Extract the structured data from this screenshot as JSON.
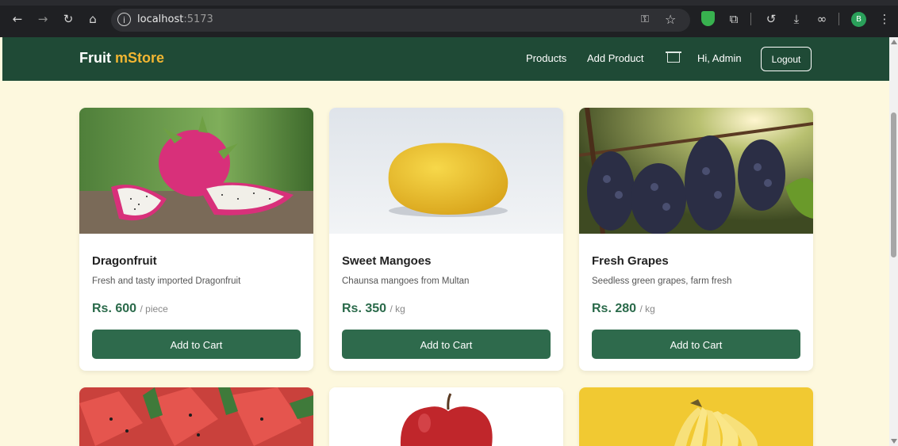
{
  "browser": {
    "host": "localhost",
    "port": ":5173",
    "profile_initial": "B"
  },
  "navbar": {
    "brand_first": "Fruit",
    "brand_second": "mStore",
    "links": [
      "Products",
      "Add Product"
    ],
    "greeting": "Hi, Admin",
    "logout_label": "Logout"
  },
  "products": [
    {
      "name": "Dragonfruit",
      "description": "Fresh and tasty imported Dragonfruit",
      "price": "Rs. 600",
      "unit": "/ piece",
      "button": "Add to Cart"
    },
    {
      "name": "Sweet Mangoes",
      "description": "Chaunsa mangoes from Multan",
      "price": "Rs. 350",
      "unit": "/ kg",
      "button": "Add to Cart"
    },
    {
      "name": "Fresh Grapes",
      "description": "Seedless green grapes, farm fresh",
      "price": "Rs. 280",
      "unit": "/ kg",
      "button": "Add to Cart"
    }
  ],
  "colors": {
    "navbar": "#1f4a36",
    "accent": "#f2b632",
    "button": "#2e6a4c",
    "background": "#fdf8de"
  }
}
